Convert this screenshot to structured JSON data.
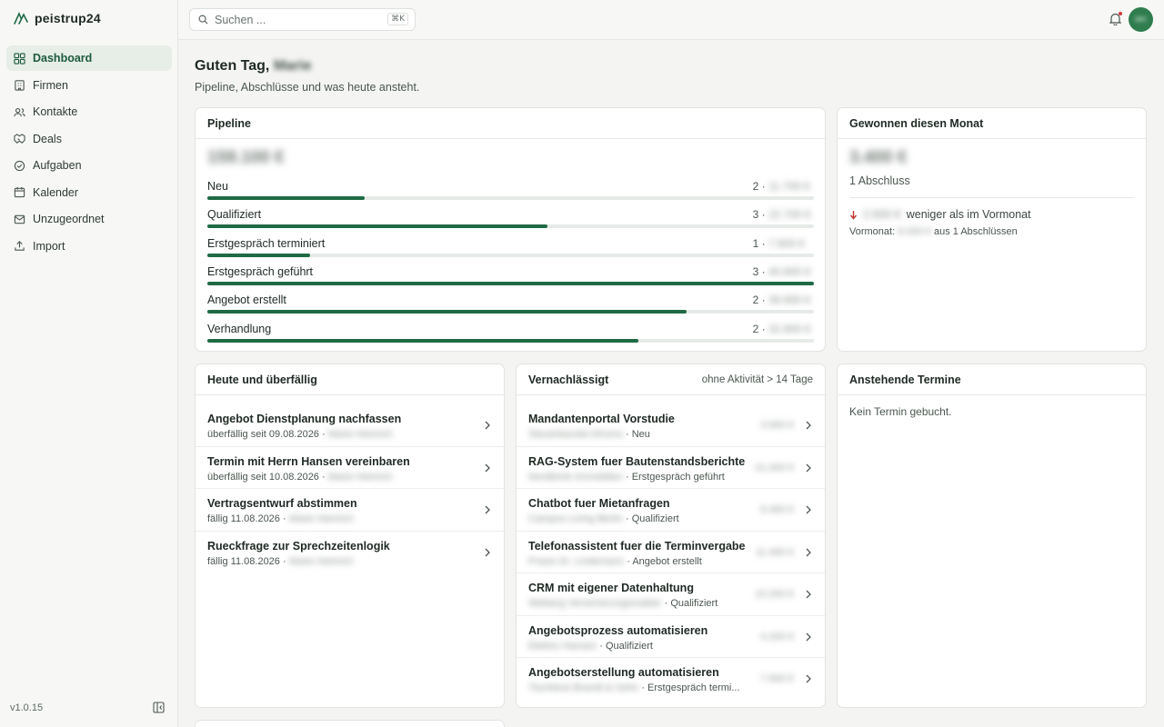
{
  "app": {
    "name": "peistrup24",
    "version": "v1.0.15"
  },
  "sidebar": {
    "items": [
      {
        "label": "Dashboard",
        "icon": "grid-icon",
        "active": true
      },
      {
        "label": "Firmen",
        "icon": "building-icon"
      },
      {
        "label": "Kontakte",
        "icon": "users-icon"
      },
      {
        "label": "Deals",
        "icon": "handshake-icon"
      },
      {
        "label": "Aufgaben",
        "icon": "check-circle-icon"
      },
      {
        "label": "Kalender",
        "icon": "calendar-icon"
      },
      {
        "label": "Unzugeordnet",
        "icon": "inbox-icon"
      },
      {
        "label": "Import",
        "icon": "upload-icon"
      }
    ]
  },
  "search": {
    "placeholder": "Suchen ...",
    "shortcut": "⌘K"
  },
  "header": {
    "greeting": "Guten Tag,",
    "name": "Marie",
    "subline": "Pipeline, Abschlüsse und was heute ansteht."
  },
  "pipeline": {
    "title": "Pipeline",
    "total": "159.100 €",
    "stages": [
      {
        "label": "Neu",
        "count": "2",
        "amount": "11.700 €",
        "share": 0.26
      },
      {
        "label": "Qualifiziert",
        "count": "3",
        "amount": "22.700 €",
        "share": 0.56
      },
      {
        "label": "Erstgespräch terminiert",
        "count": "1",
        "amount": "7.600 €",
        "share": 0.17
      },
      {
        "label": "Erstgespräch geführt",
        "count": "3",
        "amount": "40.800 €",
        "share": 1.0
      },
      {
        "label": "Angebot erstellt",
        "count": "2",
        "amount": "39.900 €",
        "share": 0.79
      },
      {
        "label": "Verhandlung",
        "count": "2",
        "amount": "32.800 €",
        "share": 0.71
      }
    ]
  },
  "won": {
    "title": "Gewonnen diesen Monat",
    "value": "3.400 €",
    "count_label": "1 Abschluss",
    "delta": "2.600 €",
    "delta_text": "weniger als im Vormonat",
    "prev_prefix": "Vormonat:",
    "prev_value": "6.000 €",
    "prev_suffix": "aus 1 Abschlüssen"
  },
  "today": {
    "title": "Heute und überfällig",
    "items": [
      {
        "title": "Angebot Dienstplanung nachfassen",
        "due": "überfällig seit 09.08.2026",
        "owner": "Marie Heinrich"
      },
      {
        "title": "Termin mit Herrn Hansen vereinbaren",
        "due": "überfällig seit 10.08.2026",
        "owner": "Marie Heinrich"
      },
      {
        "title": "Vertragsentwurf abstimmen",
        "due": "fällig 11.08.2026",
        "owner": "Marie Heinrich"
      },
      {
        "title": "Rueckfrage zur Sprechzeitenlogik",
        "due": "fällig 11.08.2026",
        "owner": "Marie Heinrich"
      }
    ]
  },
  "neglected": {
    "title": "Vernachlässigt",
    "note": "ohne Aktivität > 14 Tage",
    "items": [
      {
        "title": "Mandantenportal Vorstudie",
        "company": "Steuerkanzlei Ahrens",
        "stage": "Neu",
        "value": "3.900 €"
      },
      {
        "title": "RAG-System fuer Bautenstandsberichte",
        "company": "Nordbrink Immobilien",
        "stage": "Erstgespräch geführt",
        "value": "21.000 €"
      },
      {
        "title": "Chatbot fuer Mietanfragen",
        "company": "Campus Living Berlin",
        "stage": "Qualifiziert",
        "value": "8.300 €"
      },
      {
        "title": "Telefonassistent fuer die Terminvergabe",
        "company": "Praxis Dr. Lindemann",
        "stage": "Angebot erstellt",
        "value": "11.400 €"
      },
      {
        "title": "CRM mit eigener Datenhaltung",
        "company": "Weiberg Versicherungsmakler",
        "stage": "Qualifiziert",
        "value": "10.200 €"
      },
      {
        "title": "Angebotsprozess automatisieren",
        "company": "Elektro Hansen",
        "stage": "Qualifiziert",
        "value": "4.200 €"
      },
      {
        "title": "Angebotserstellung automatisieren",
        "company": "Tischlerei Brandt & Sohn",
        "stage": "Erstgespräch termi...",
        "value": "7.600 €"
      }
    ]
  },
  "appointments": {
    "title": "Anstehende Termine",
    "empty": "Kein Termin gebucht."
  },
  "colors": {
    "accent": "#1e6a44",
    "sidebar_active": "#e6eee7",
    "alert": "#d03b3b"
  }
}
